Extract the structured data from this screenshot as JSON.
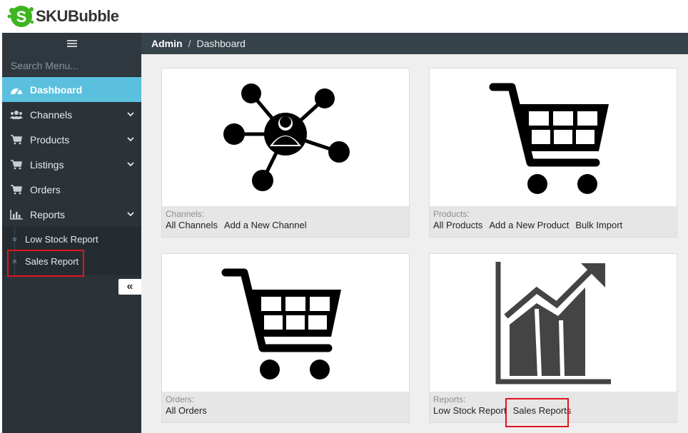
{
  "brand": {
    "name": "SKUBubble",
    "badge_letter": "S"
  },
  "sidebar": {
    "menu_icon": "hamburger-icon",
    "search_placeholder": "Search Menu...",
    "items": [
      {
        "label": "Dashboard",
        "icon": "dashboard-icon",
        "active": true
      },
      {
        "label": "Channels",
        "icon": "users-icon",
        "expandable": true
      },
      {
        "label": "Products",
        "icon": "cart-icon",
        "expandable": true
      },
      {
        "label": "Listings",
        "icon": "cart-icon",
        "expandable": true
      },
      {
        "label": "Orders",
        "icon": "cart-icon",
        "expandable": false
      },
      {
        "label": "Reports",
        "icon": "bar-chart-icon",
        "expandable": true
      }
    ],
    "reports_submenu": [
      {
        "label": "Low Stock Report"
      },
      {
        "label": "Sales Report"
      }
    ],
    "collapse_label": "«"
  },
  "breadcrumb": {
    "root": "Admin",
    "separator": "/",
    "current": "Dashboard"
  },
  "cards": [
    {
      "title": "Channels:",
      "links": [
        "All Channels",
        "Add a New Channel"
      ],
      "image": "network-people-icon"
    },
    {
      "title": "Products:",
      "links": [
        "All Products",
        "Add a New Product",
        "Bulk Import"
      ],
      "image": "shopping-cart-icon"
    },
    {
      "title": "Orders:",
      "links": [
        "All Orders"
      ],
      "image": "shopping-cart-icon"
    },
    {
      "title": "Reports:",
      "links": [
        "Low Stock Report",
        "Sales Reports"
      ],
      "image": "growth-chart-icon"
    }
  ],
  "colors": {
    "accent": "#5bc0de",
    "sidebar_bg": "#2b3339",
    "breadcrumb_bg": "#37434b",
    "highlight": "#e0141e",
    "logo_green": "#3cb521"
  }
}
